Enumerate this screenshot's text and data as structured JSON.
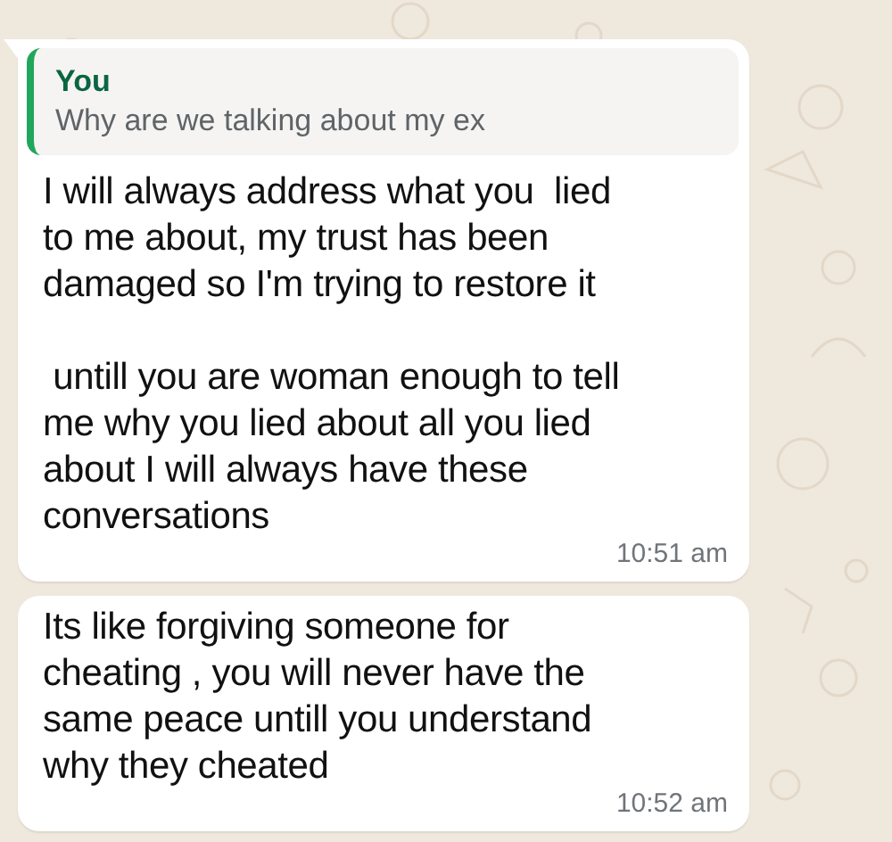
{
  "messages": [
    {
      "quote": {
        "author": "You",
        "text": "Why are we talking about my ex"
      },
      "text": "I will always address what you  lied\nto me about, my trust has been\ndamaged so I'm trying to restore it\n\n untill you are woman enough to tell\nme why you lied about all you lied\nabout I will always have these\nconversations",
      "time": "10:51 am",
      "tail": true
    },
    {
      "text": "Its like forgiving someone for\ncheating , you will never have the\nsame peace untill you understand\nwhy they cheated",
      "time": "10:52 am",
      "tail": false
    }
  ]
}
